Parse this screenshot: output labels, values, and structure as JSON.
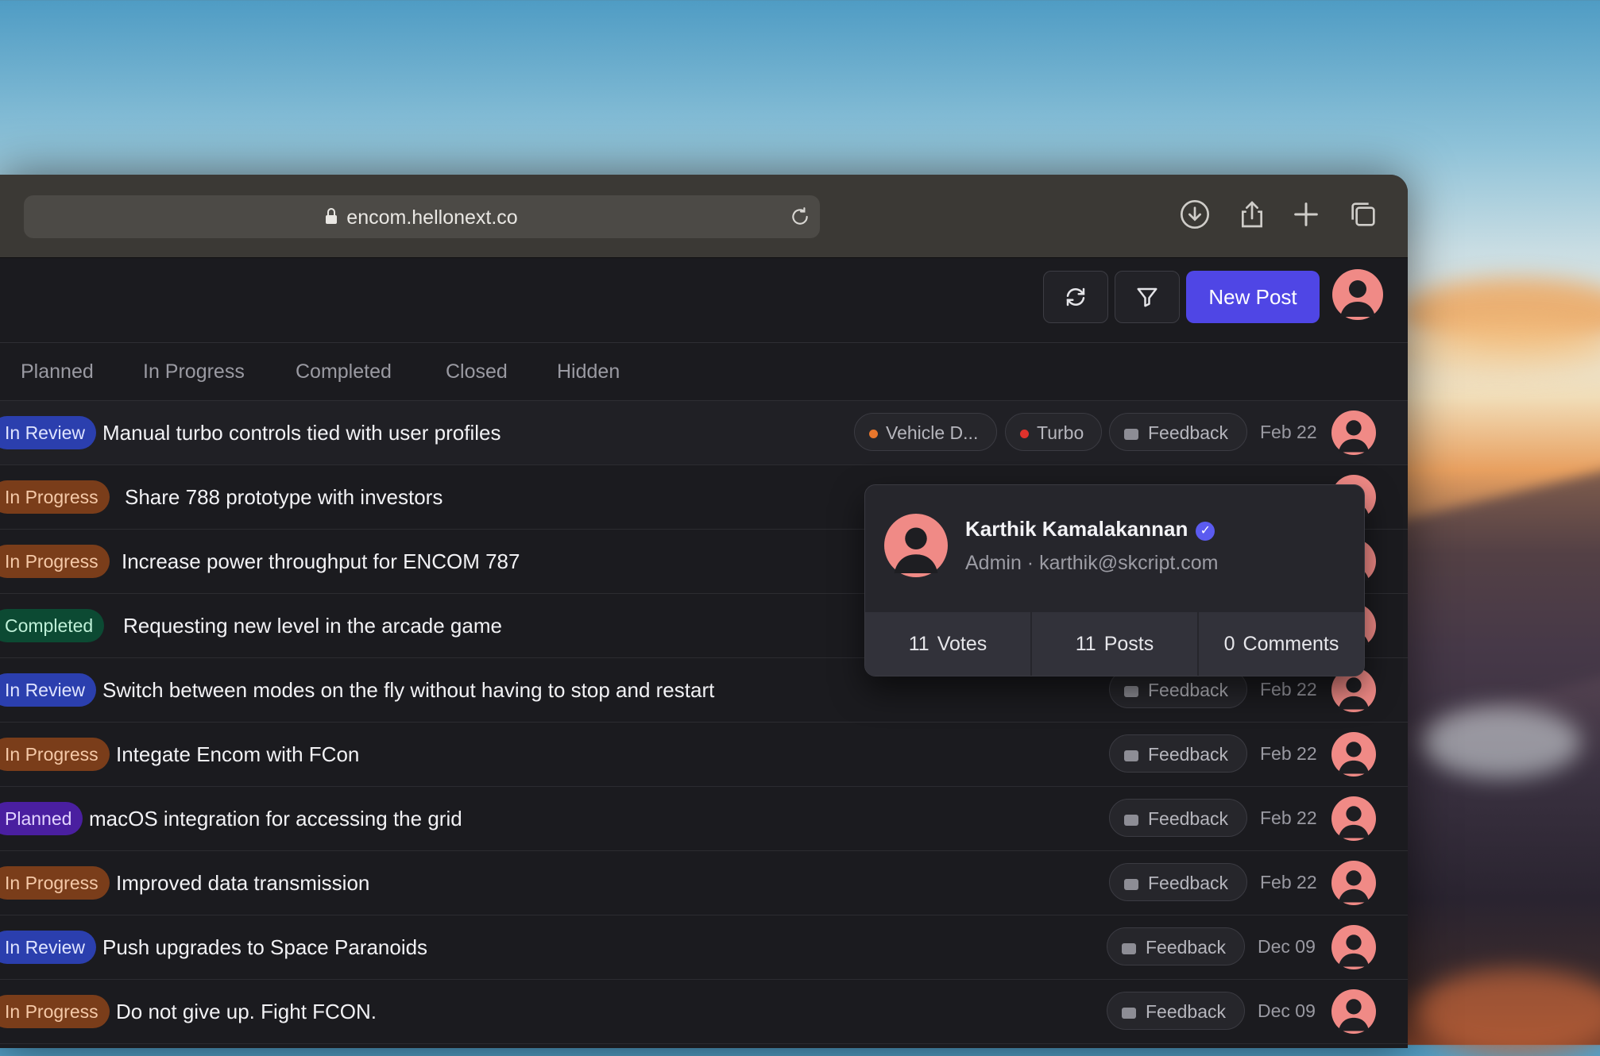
{
  "browser": {
    "url": "encom.hellonext.co"
  },
  "header": {
    "new_post_label": "New Post"
  },
  "tabs": [
    "Planned",
    "In Progress",
    "Completed",
    "Closed",
    "Hidden"
  ],
  "colors": {
    "accent": "#4f46e5",
    "review": "#2b3fae",
    "progress": "#7a3d1a",
    "completed": "#0c4a33",
    "planned": "#4a1fa0"
  },
  "rows": [
    {
      "status": "In Review",
      "title": "Manual turbo controls tied with user profiles",
      "tags": [
        "Vehicle D...",
        "Turbo",
        "Feedback"
      ],
      "date": "Feb 22"
    },
    {
      "status": "In Progress",
      "title": "Share 788 prototype with investors",
      "tags": [],
      "date": ""
    },
    {
      "status": "In Progress",
      "title": "Increase power throughput for ENCOM 787",
      "tags": [],
      "date": ""
    },
    {
      "status": "Completed",
      "title": "Requesting new level in the arcade game",
      "tags": [],
      "date": ""
    },
    {
      "status": "In Review",
      "title": "Switch between modes on the fly without having to stop and restart",
      "tags": [
        "Feedback"
      ],
      "date": "Feb 22"
    },
    {
      "status": "In Progress",
      "title": "Integate Encom with FCon",
      "tags": [
        "Feedback"
      ],
      "date": "Feb 22"
    },
    {
      "status": "Planned",
      "title": "macOS integration for accessing the grid",
      "tags": [
        "Feedback"
      ],
      "date": "Feb 22"
    },
    {
      "status": "In Progress",
      "title": "Improved data transmission",
      "tags": [
        "Feedback"
      ],
      "date": "Feb 22"
    },
    {
      "status": "In Review",
      "title": "Push upgrades to Space Paranoids",
      "tags": [
        "Feedback"
      ],
      "date": "Dec 09"
    },
    {
      "status": "In Progress",
      "title": "Do not give up. Fight FCON.",
      "tags": [
        "Feedback"
      ],
      "date": "Dec 09"
    }
  ],
  "popup": {
    "name": "Karthik Kamalakannan",
    "subtitle": "Admin · karthik@skcript.com",
    "votes_count": "11",
    "votes_label": "Votes",
    "posts_count": "11",
    "posts_label": "Posts",
    "comments_count": "0",
    "comments_label": "Comments"
  }
}
